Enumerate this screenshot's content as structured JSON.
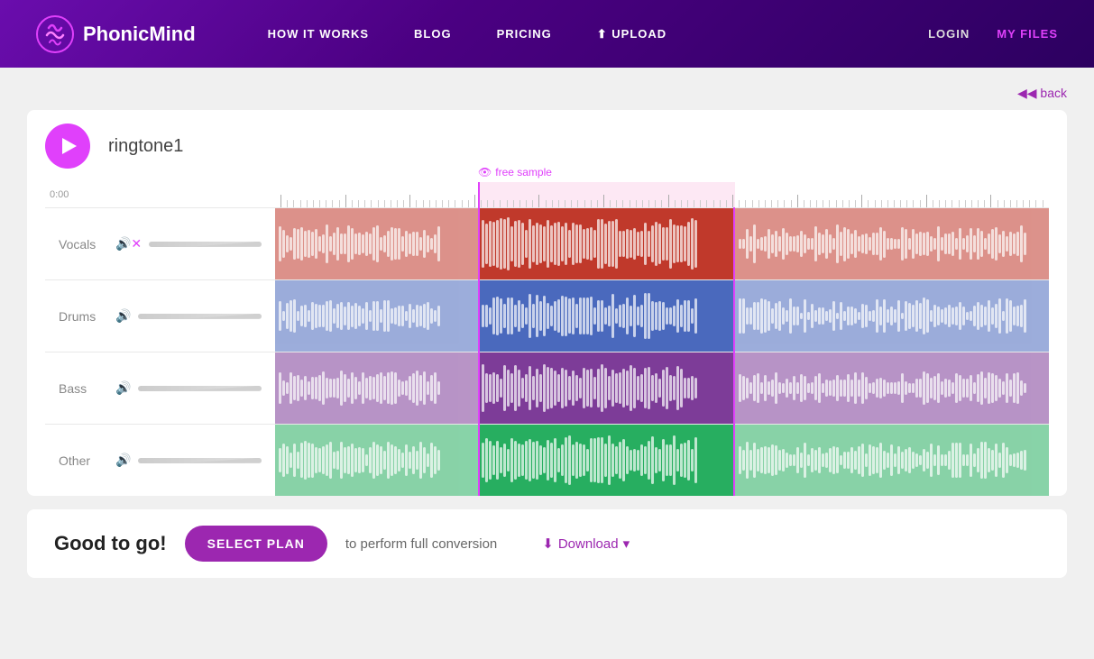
{
  "navbar": {
    "logo_text": "PhonicMind",
    "links": [
      {
        "label": "HOW IT WORKS",
        "id": "how-it-works"
      },
      {
        "label": "BLOG",
        "id": "blog"
      },
      {
        "label": "PRICING",
        "id": "pricing"
      },
      {
        "label": "⬆ UPLOAD",
        "id": "upload"
      }
    ],
    "login_label": "LOGIN",
    "myfiles_label": "MY FILES"
  },
  "back_label": "◀◀ back",
  "player": {
    "song_title": "ringtone1",
    "time_label": "0:00",
    "free_sample_label": "free sample"
  },
  "tracks": [
    {
      "name": "Vocals",
      "muted": true,
      "color": "vocals"
    },
    {
      "name": "Drums",
      "muted": false,
      "color": "drums"
    },
    {
      "name": "Bass",
      "muted": false,
      "color": "bass"
    },
    {
      "name": "Other",
      "muted": false,
      "color": "other"
    }
  ],
  "bottom_bar": {
    "good_to_go": "Good to go!",
    "select_plan_label": "SELECT PLAN",
    "to_perform_text": "to perform full conversion",
    "download_label": "Download",
    "download_arrow": "▾"
  }
}
